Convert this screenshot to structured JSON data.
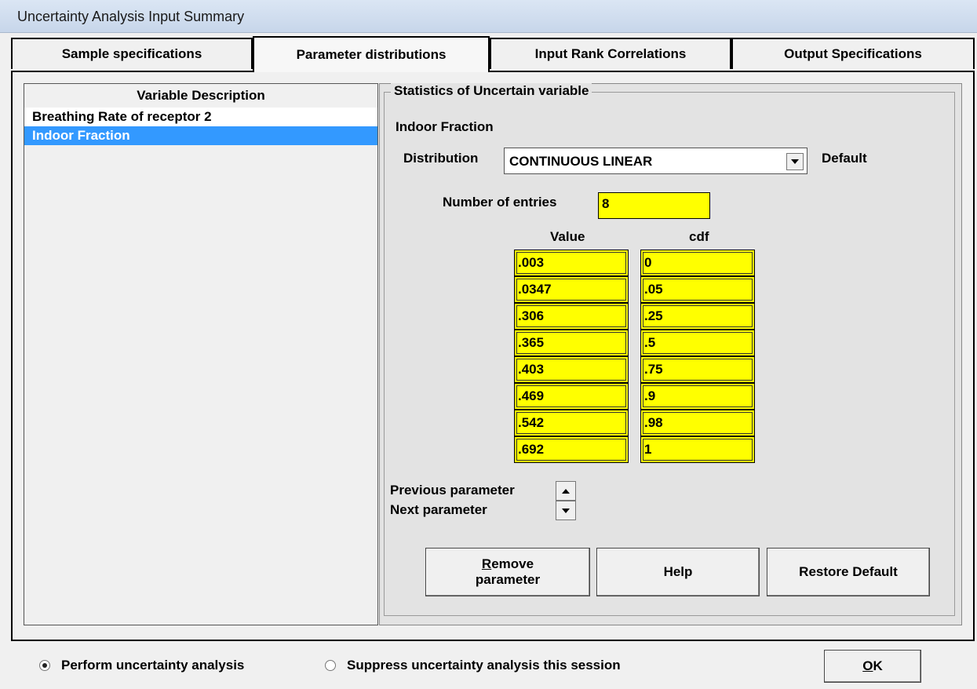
{
  "window": {
    "title": "Uncertainty Analysis Input Summary"
  },
  "tabs": [
    {
      "label": "Sample specifications"
    },
    {
      "label": "Parameter distributions"
    },
    {
      "label": "Input Rank Correlations"
    },
    {
      "label": "Output Specifications"
    }
  ],
  "active_tab": "Parameter distributions",
  "variable_list": {
    "header": "Variable Description",
    "items": [
      {
        "label": "Breathing Rate of receptor  2",
        "selected": false
      },
      {
        "label": "Indoor Fraction",
        "selected": true
      }
    ]
  },
  "stats": {
    "group_title": "Statistics of Uncertain variable",
    "variable_name": "Indoor Fraction",
    "distribution_label": "Distribution",
    "distribution_value": "CONTINUOUS LINEAR",
    "default_label": "Default",
    "entries_label": "Number of entries",
    "entries_value": "8",
    "value_header": "Value",
    "cdf_header": "cdf",
    "values": [
      ".003",
      ".0347",
      ".306",
      ".365",
      ".403",
      ".469",
      ".542",
      ".692"
    ],
    "cdf": [
      "0",
      ".05",
      ".25",
      ".5",
      ".75",
      ".9",
      ".98",
      "1"
    ],
    "previous_label": "Previous parameter",
    "next_label": "Next parameter"
  },
  "buttons": {
    "remove_line1_accel": "R",
    "remove_line1_rest": "emove",
    "remove_line2": "parameter",
    "help": "Help",
    "restore": "Restore Default"
  },
  "bottom": {
    "perform_label": "Perform uncertainty analysis",
    "suppress_label": "Suppress uncertainty analysis this session",
    "perform_selected": true,
    "ok_accel": "O",
    "ok_rest": "K"
  }
}
